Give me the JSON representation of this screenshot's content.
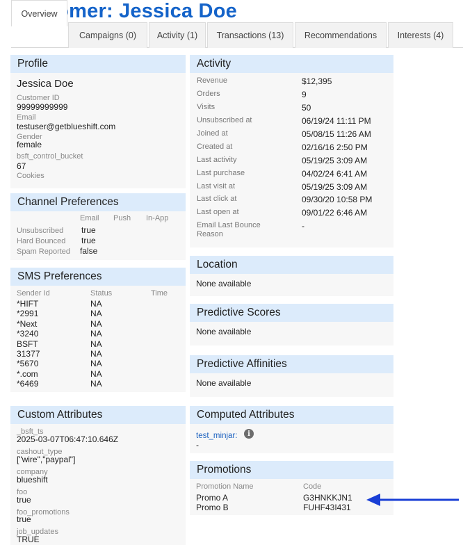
{
  "page": {
    "title": "Customer: Jessica Doe"
  },
  "tabs": [
    {
      "label": "Overview",
      "active": true
    },
    {
      "label": "Campaigns (0)"
    },
    {
      "label": "Activity (1)"
    },
    {
      "label": "Transactions (13)"
    },
    {
      "label": "Recommendations"
    },
    {
      "label": "Interests (4)"
    }
  ],
  "profile": {
    "heading": "Profile",
    "name": "Jessica Doe",
    "fields": [
      {
        "label": "Customer ID",
        "value": "99999999999"
      },
      {
        "label": "Email",
        "value": "testuser@getblueshift.com"
      },
      {
        "label": "Gender",
        "value": "female"
      },
      {
        "label": "bsft_control_bucket",
        "value": "67"
      },
      {
        "label": "Cookies",
        "value": ""
      }
    ]
  },
  "channel_preferences": {
    "heading": "Channel Preferences",
    "columns": [
      "Email",
      "Push",
      "In-App"
    ],
    "rows": [
      {
        "label": "Unsubscribed",
        "email": "true"
      },
      {
        "label": "Hard Bounced",
        "email": "true"
      },
      {
        "label": "Spam Reported",
        "email": "false"
      }
    ]
  },
  "sms_preferences": {
    "heading": "SMS Preferences",
    "columns": [
      "Sender Id",
      "Status",
      "Time"
    ],
    "rows": [
      {
        "sender": "*HIFT",
        "status": "NA"
      },
      {
        "sender": "*2991",
        "status": "NA"
      },
      {
        "sender": "*Next",
        "status": "NA"
      },
      {
        "sender": "*3240",
        "status": "NA"
      },
      {
        "sender": "BSFT",
        "status": "NA"
      },
      {
        "sender": "31377",
        "status": "NA"
      },
      {
        "sender": "*5670",
        "status": "NA"
      },
      {
        "sender": "*.com",
        "status": "NA"
      },
      {
        "sender": "*6469",
        "status": "NA"
      }
    ]
  },
  "custom_attributes": {
    "heading": "Custom Attributes",
    "fields": [
      {
        "label": "_bsft_ts",
        "value": "2025-03-07T06:47:10.646Z"
      },
      {
        "label": "cashout_type",
        "value": "[\"wire\",\"paypal\"]"
      },
      {
        "label": "company",
        "value": "blueshift"
      },
      {
        "label": "foo",
        "value": "true"
      },
      {
        "label": "foo_promotions",
        "value": "true"
      },
      {
        "label": "job_updates",
        "value": "TRUE"
      }
    ]
  },
  "activity": {
    "heading": "Activity",
    "rows": [
      {
        "label": "Revenue",
        "value": "$12,395"
      },
      {
        "label": "Orders",
        "value": "9"
      },
      {
        "label": "Visits",
        "value": "50"
      },
      {
        "label": "Unsubscribed at",
        "value": "06/19/24 11:11 PM"
      },
      {
        "label": "Joined at",
        "value": "05/08/15 11:26 AM"
      },
      {
        "label": "Created at",
        "value": "02/16/16 2:50 PM"
      },
      {
        "label": "Last activity",
        "value": "05/19/25 3:09 AM"
      },
      {
        "label": "Last purchase",
        "value": "04/02/24 6:41 AM"
      },
      {
        "label": "Last visit at",
        "value": "05/19/25 3:09 AM"
      },
      {
        "label": "Last click at",
        "value": "09/30/20 10:58 PM"
      },
      {
        "label": "Last open at",
        "value": "09/01/22 6:46 AM"
      }
    ],
    "bounce": {
      "label": "Email Last Bounce Reason",
      "value": "-"
    }
  },
  "location": {
    "heading": "Location",
    "body": "None available"
  },
  "predictive_scores": {
    "heading": "Predictive Scores",
    "body": "None available"
  },
  "predictive_affinities": {
    "heading": "Predictive Affinities",
    "body": "None available"
  },
  "computed_attributes": {
    "heading": "Computed Attributes",
    "link": "test_minjar:",
    "value": "-",
    "info_icon": "info-icon"
  },
  "promotions": {
    "heading": "Promotions",
    "columns": [
      "Promotion Name",
      "Code"
    ],
    "rows": [
      {
        "name": "Promo A",
        "code": "G3HNKKJN1"
      },
      {
        "name": "Promo B",
        "code": "FUHF43I431"
      }
    ]
  },
  "annotation": {
    "icon": "arrow-left-icon",
    "color": "#1a3fd6"
  }
}
